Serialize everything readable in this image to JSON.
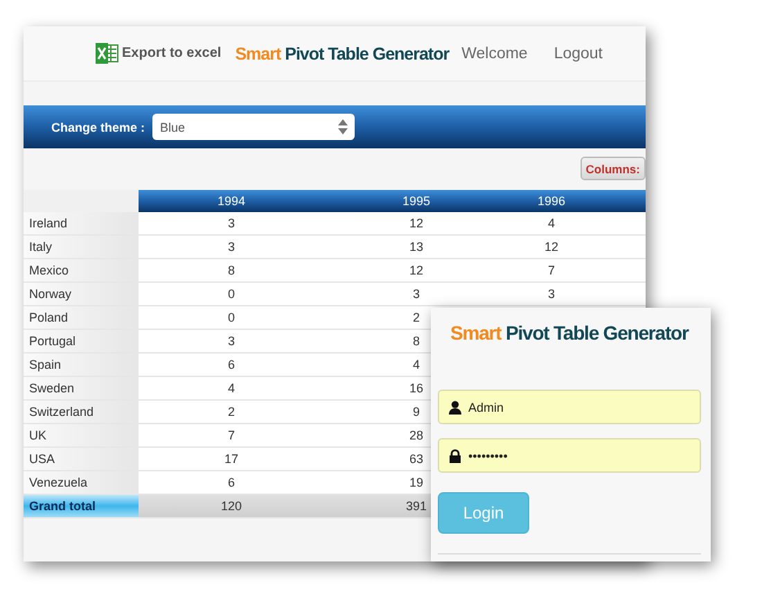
{
  "header": {
    "export_label": "Export to excel",
    "title": {
      "accent": "Smart",
      "rest": "Pivot Table Generator"
    },
    "nav": [
      "Welcome",
      "Logout"
    ]
  },
  "theme": {
    "label": "Change theme :",
    "value": "Blue"
  },
  "columns_button": "Columns:",
  "table": {
    "columns": [
      "1994",
      "1995",
      "1996"
    ],
    "rows": [
      {
        "label": "Ireland",
        "values": [
          "3",
          "12",
          "4"
        ]
      },
      {
        "label": "Italy",
        "values": [
          "3",
          "13",
          "12"
        ]
      },
      {
        "label": "Mexico",
        "values": [
          "8",
          "12",
          "7"
        ]
      },
      {
        "label": "Norway",
        "values": [
          "0",
          "3",
          "3"
        ]
      },
      {
        "label": "Poland",
        "values": [
          "0",
          "2"
        ]
      },
      {
        "label": "Portugal",
        "values": [
          "3",
          "8"
        ]
      },
      {
        "label": "Spain",
        "values": [
          "6",
          "4"
        ]
      },
      {
        "label": "Sweden",
        "values": [
          "4",
          "16"
        ]
      },
      {
        "label": "Switzerland",
        "values": [
          "2",
          "9"
        ]
      },
      {
        "label": "UK",
        "values": [
          "7",
          "28"
        ]
      },
      {
        "label": "USA",
        "values": [
          "17",
          "63"
        ]
      },
      {
        "label": "Venezuela",
        "values": [
          "6",
          "19"
        ]
      }
    ],
    "grand_total": {
      "label": "Grand total",
      "values": [
        "120",
        "391"
      ]
    }
  },
  "login": {
    "title": {
      "accent": "Smart",
      "rest": "Pivot Table Generator"
    },
    "username": "Admin",
    "password": "•••••••••",
    "button": "Login"
  }
}
